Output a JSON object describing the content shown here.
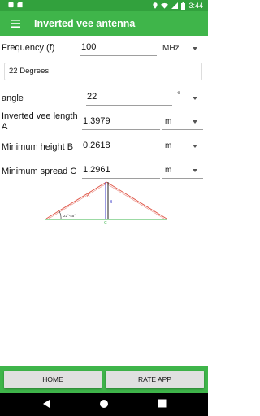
{
  "status_bar": {
    "time": "3:44",
    "icons": [
      "notification-icon",
      "sd-card-icon",
      "location-icon",
      "wifi-icon",
      "signal-icon",
      "battery-icon"
    ]
  },
  "app_bar": {
    "title": "Inverted vee antenna",
    "menu_icon": "hamburger-menu-icon"
  },
  "form": {
    "frequency": {
      "label": "Frequency (f)",
      "value": "100",
      "unit": "MHz"
    },
    "degrees_display": "22 Degrees",
    "angle": {
      "label": "angle",
      "value": "22",
      "unit": "°"
    },
    "length": {
      "label": "Inverted vee length A",
      "value": "1.3979",
      "unit": "m"
    },
    "min_height": {
      "label": "Minimum height B",
      "value": "0.2618",
      "unit": "m"
    },
    "min_spread": {
      "label": "Minimum spread C",
      "value": "1.2961",
      "unit": "m"
    }
  },
  "diagram": {
    "label_a": "A",
    "label_b": "B",
    "label_c": "C",
    "angle_label": "22°-45°",
    "colors": {
      "legs": "#e0584a",
      "mast": "#3d3dc8",
      "ground": "#39b54a"
    }
  },
  "buttons": {
    "home": "HOME",
    "rate": "RATE APP"
  },
  "colors": {
    "status_bar": "#32a13d",
    "app_bar": "#3fb54a",
    "button_bg": "#e0e0e0"
  }
}
